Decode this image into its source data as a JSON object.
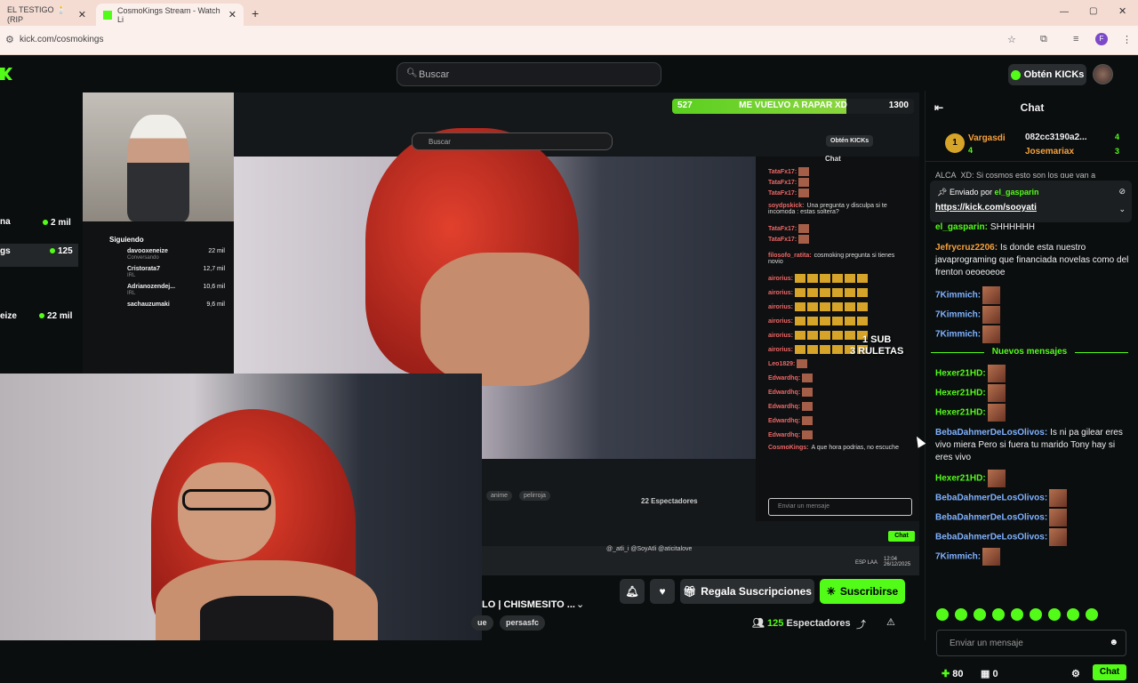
{
  "browser": {
    "tabs": [
      {
        "title": "EL TESTIGO 🕯️ (RIP"
      },
      {
        "title": "CosmoKings Stream - Watch Li"
      }
    ],
    "url": "kick.com/cosmokings",
    "profile_initial": "F"
  },
  "header": {
    "search_placeholder": "Buscar",
    "get_kicks": "Obtén KICKs"
  },
  "sidebar": {
    "items": [
      {
        "name": "na",
        "count": "2 mil"
      },
      {
        "name": "gs",
        "count": "125"
      },
      {
        "name": "eize",
        "count": "22 mil"
      }
    ]
  },
  "stream": {
    "goal": {
      "left": "527",
      "title": "ME VUELVO A RAPAR XD",
      "right": "1300"
    },
    "inner_search": "Buscar",
    "inner_get_kicks": "Obtén KICKs",
    "inner_chat_title": "Chat",
    "following_title": "Siguiendo",
    "following": [
      {
        "name": "davooxeneize",
        "sub": "Conversando",
        "count": "22 mil"
      },
      {
        "name": "Cristorata7",
        "sub": "IRL",
        "count": "12,7 mil"
      },
      {
        "name": "Adrianozendej...",
        "sub": "IRL",
        "count": "10,6 mil"
      },
      {
        "name": "sachauzumaki",
        "sub": "",
        "count": "9,6 mil"
      }
    ],
    "inner_chat": [
      {
        "user": "TataFx17:",
        "text": ""
      },
      {
        "user": "TataFx17:",
        "text": ""
      },
      {
        "user": "TataFx17:",
        "text": ""
      },
      {
        "user": "soydpskick:",
        "text": "Una pregunta y disculpa si te incomoda : estas soltera?"
      },
      {
        "user": "TataFx17:",
        "text": ""
      },
      {
        "user": "TataFx17:",
        "text": ""
      },
      {
        "user": "filosofo_ratita:",
        "text": "cosmoking pregunta si tienes novio"
      },
      {
        "user": "airorius:",
        "text": ""
      },
      {
        "user": "airorius:",
        "text": ""
      },
      {
        "user": "airorius:",
        "text": ""
      },
      {
        "user": "airorius:",
        "text": ""
      },
      {
        "user": "airorius:",
        "text": ""
      },
      {
        "user": "airorius:",
        "text": ""
      },
      {
        "user": "Leo1829:",
        "text": ""
      },
      {
        "user": "Edwardhq:",
        "text": ""
      },
      {
        "user": "Edwardhq:",
        "text": ""
      },
      {
        "user": "Edwardhq:",
        "text": ""
      },
      {
        "user": "Edwardhq:",
        "text": ""
      },
      {
        "user": "Edwardhq:",
        "text": ""
      },
      {
        "user": "CosmoKings:",
        "text": "A que hora podrias, no escuche"
      }
    ],
    "overlay_text_1": "1 SUB",
    "overlay_text_2": "3 RULETAS",
    "inner_chat_input": "Enviar un mensaje",
    "inner_chat_btn": "Chat",
    "inner_viewers": "22 Espectadores",
    "inner_tags": [
      "anime",
      "pelirroja"
    ],
    "socials": "@_atli_i   @SoyAtli   @aticitalove",
    "clock_time": "12:04",
    "clock_date": "26/12/2025",
    "lang": "ESP LAA"
  },
  "bottom": {
    "title": "LO | CHISMESITO ...",
    "tags": [
      "ue",
      "persasfc"
    ],
    "gift_btn": "Regala Suscripciones",
    "sub_btn": "Suscribirse",
    "viewers_count": "125",
    "viewers_label": "Espectadores"
  },
  "chat": {
    "title": "Chat",
    "gifters": [
      {
        "rank": "1",
        "name": "Vargasdi",
        "count": "4"
      },
      {
        "rank": "",
        "name": "082cc3190a2...",
        "count": "4"
      },
      {
        "rank": "",
        "name": "Josemariax",
        "count": "3"
      }
    ],
    "pinned_by_label": "Enviado por",
    "pinned_by_user": "el_gasparin",
    "pinned_link": "https://kick.com/sooyati",
    "pinned_above": "ALCA_XD: Si cosmos esto son los que van a",
    "messages_top": [
      {
        "user": "el_gasparin:",
        "text": "SHHHHHH",
        "color": "#53fc18"
      },
      {
        "user": "Jefrycruz2206:",
        "text": "Is donde esta nuestro javaprograming que financiada novelas como del frenton oeoeoeoe",
        "color": "#f8a23b"
      },
      {
        "user": "7Kimmich:",
        "text": "",
        "color": "#7fb2ff"
      },
      {
        "user": "7Kimmich:",
        "text": "",
        "color": "#7fb2ff"
      },
      {
        "user": "7Kimmich:",
        "text": "",
        "color": "#7fb2ff"
      }
    ],
    "new_messages": "Nuevos mensajes",
    "messages_bottom": [
      {
        "user": "Hexer21HD:",
        "text": "",
        "color": "#53fc18"
      },
      {
        "user": "Hexer21HD:",
        "text": "",
        "color": "#53fc18"
      },
      {
        "user": "Hexer21HD:",
        "text": "",
        "color": "#53fc18"
      },
      {
        "user": "BebaDahmerDeLosOlivos:",
        "text": "Is ni pa gilear eres vivo miera Pero si fuera tu marido Tony hay si eres vivo",
        "color": "#7fb2ff"
      },
      {
        "user": "Hexer21HD:",
        "text": "",
        "color": "#53fc18"
      },
      {
        "user": "BebaDahmerDeLosOlivos:",
        "text": "",
        "color": "#7fb2ff"
      },
      {
        "user": "BebaDahmerDeLosOlivos:",
        "text": "",
        "color": "#7fb2ff"
      },
      {
        "user": "BebaDahmerDeLosOlivos:",
        "text": "",
        "color": "#7fb2ff"
      },
      {
        "user": "7Kimmich:",
        "text": "",
        "color": "#7fb2ff"
      }
    ],
    "input_placeholder": "Enviar un mensaje",
    "kicks_count": "80",
    "gift_count": "0",
    "chat_button": "Chat"
  },
  "colors": {
    "accent": "#53fc18",
    "bg": "#0b0e0f",
    "panel": "#1c1f21"
  }
}
